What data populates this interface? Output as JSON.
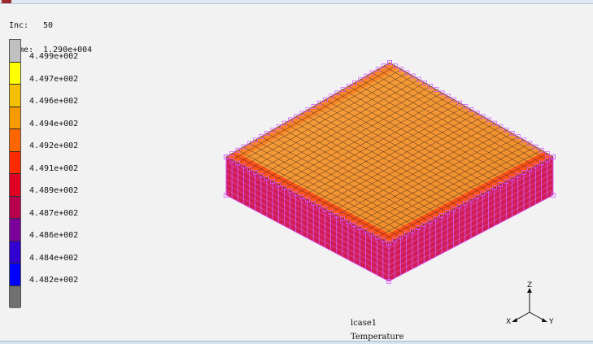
{
  "window": {
    "title": ""
  },
  "info": {
    "inc_label": "Inc:",
    "inc_value": "50",
    "time_label": "Time:",
    "time_value": "1.290e+004"
  },
  "legend": {
    "labels": [
      "4.499e+002",
      "4.497e+002",
      "4.496e+002",
      "4.494e+002",
      "4.492e+002",
      "4.491e+002",
      "4.489e+002",
      "4.487e+002",
      "4.486e+002",
      "4.484e+002",
      "4.482e+002"
    ],
    "colors": [
      "#c0c0c0",
      "#ffff00",
      "#f4c000",
      "#f59a00",
      "#ff6600",
      "#ff2a00",
      "#e00024",
      "#b8004f",
      "#7a0099",
      "#3200d0",
      "#0000ff",
      "#707070"
    ]
  },
  "caption": {
    "load_case": "lcase1",
    "result": "Temperature"
  },
  "triad": {
    "z": "Z",
    "x": "X",
    "y": "Y"
  },
  "colors": {
    "top_face": "#f29a32",
    "edge_band": "#ff1e1e",
    "mesh_line": "#3a2018",
    "boundary_magenta": "#d85cff"
  }
}
